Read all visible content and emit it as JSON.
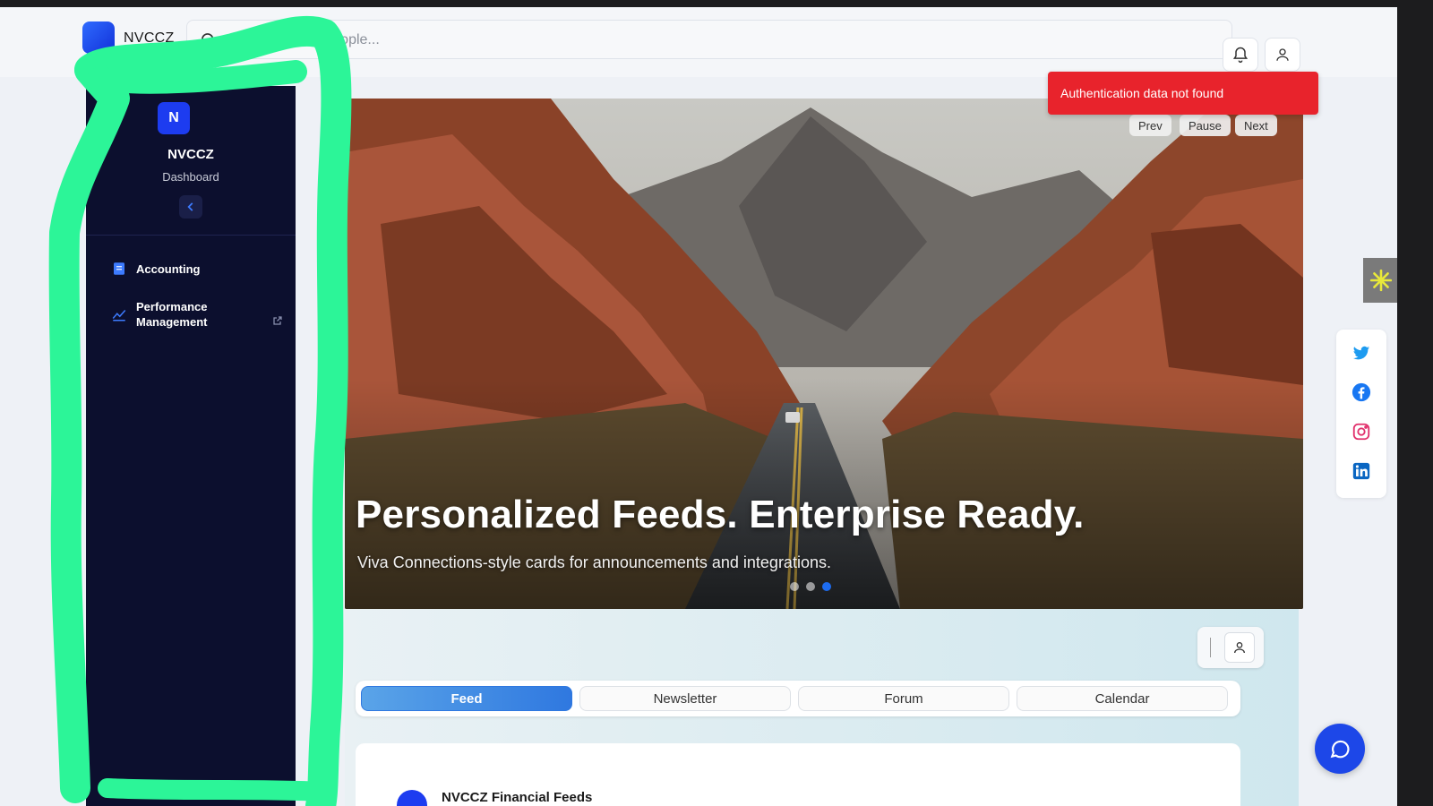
{
  "app": {
    "name": "NVCCZ"
  },
  "search": {
    "placeholder": "Search tickets, people..."
  },
  "header": {
    "icons": [
      "bell-icon",
      "user-icon"
    ]
  },
  "sidebar": {
    "avatar_letter": "N",
    "title": "NVCCZ",
    "subtitle": "Dashboard",
    "items": [
      {
        "label": "Accounting",
        "icon": "document-icon"
      },
      {
        "label": "Performance Management",
        "icon": "chart-line-icon",
        "external": true
      }
    ]
  },
  "toast": {
    "message": "Authentication data not found",
    "color": "#e8232c"
  },
  "hero": {
    "title": "Personalized Feeds. Enterprise Ready.",
    "subtitle": "Viva Connections-style cards for announcements and integrations.",
    "controls": {
      "prev": "Prev",
      "pause": "Pause",
      "next": "Next"
    },
    "slide_count": 3,
    "active_slide": 3
  },
  "social": [
    "twitter-icon",
    "facebook-icon",
    "instagram-icon",
    "linkedin-icon"
  ],
  "tabs": [
    {
      "label": "Feed",
      "active": true
    },
    {
      "label": "Newsletter",
      "active": false
    },
    {
      "label": "Forum",
      "active": false
    },
    {
      "label": "Calendar",
      "active": false
    }
  ],
  "feed": {
    "first_card_title": "NVCCZ Financial Feeds"
  },
  "colors": {
    "accent": "#1d47e8",
    "sidebar_bg": "#0c0f2e",
    "annotation": "#2cf598"
  }
}
